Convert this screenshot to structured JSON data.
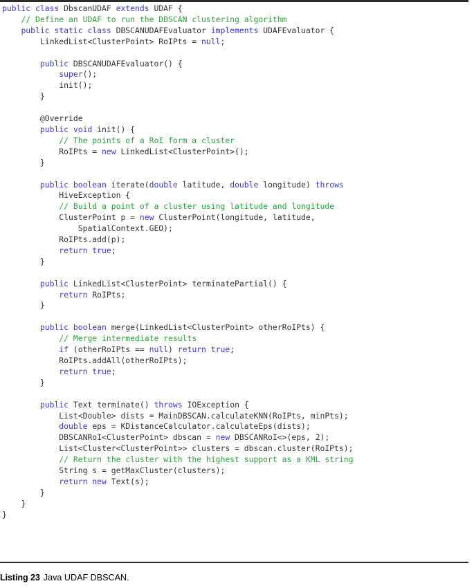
{
  "figure": {
    "kind": "code-listing",
    "caption_label": "Listing 23",
    "caption_text": "Java UDAF DBSCAN.",
    "language": "Java",
    "colors": {
      "keyword": "#3b3bd4",
      "comment": "#2fa33f",
      "plain": "#333333",
      "rule": "#2b2b2b",
      "background": "#ffffff"
    }
  },
  "code": {
    "lines": [
      [
        {
          "t": "k",
          "v": "public class "
        },
        {
          "t": "p",
          "v": "DbscanUDAF "
        },
        {
          "t": "k",
          "v": "extends "
        },
        {
          "t": "p",
          "v": "UDAF {"
        }
      ],
      [
        {
          "t": "p",
          "v": "    "
        },
        {
          "t": "c",
          "v": "// Define an UDAF to run the DBSCAN clustering algorithm"
        }
      ],
      [
        {
          "t": "p",
          "v": "    "
        },
        {
          "t": "k",
          "v": "public static class "
        },
        {
          "t": "p",
          "v": "DBSCANUDAFEvaluator "
        },
        {
          "t": "k",
          "v": "implements "
        },
        {
          "t": "p",
          "v": "UDAFEvaluator {"
        }
      ],
      [
        {
          "t": "p",
          "v": "        LinkedList<ClusterPoint> RoIPts = "
        },
        {
          "t": "k",
          "v": "null"
        },
        {
          "t": "p",
          "v": ";"
        }
      ],
      [
        {
          "t": "p",
          "v": ""
        }
      ],
      [
        {
          "t": "p",
          "v": "        "
        },
        {
          "t": "k",
          "v": "public "
        },
        {
          "t": "p",
          "v": "DBSCANUDAFEvaluator() {"
        }
      ],
      [
        {
          "t": "p",
          "v": "            "
        },
        {
          "t": "k",
          "v": "super"
        },
        {
          "t": "p",
          "v": "();"
        }
      ],
      [
        {
          "t": "p",
          "v": "            init();"
        }
      ],
      [
        {
          "t": "p",
          "v": "        }"
        }
      ],
      [
        {
          "t": "p",
          "v": ""
        }
      ],
      [
        {
          "t": "p",
          "v": "        @Override"
        }
      ],
      [
        {
          "t": "p",
          "v": "        "
        },
        {
          "t": "k",
          "v": "public void "
        },
        {
          "t": "p",
          "v": "init() {"
        }
      ],
      [
        {
          "t": "p",
          "v": "            "
        },
        {
          "t": "c",
          "v": "// The points of a RoI form a cluster"
        }
      ],
      [
        {
          "t": "p",
          "v": "            RoIPts = "
        },
        {
          "t": "k",
          "v": "new "
        },
        {
          "t": "p",
          "v": "LinkedList<ClusterPoint>();"
        }
      ],
      [
        {
          "t": "p",
          "v": "        }"
        }
      ],
      [
        {
          "t": "p",
          "v": ""
        }
      ],
      [
        {
          "t": "p",
          "v": "        "
        },
        {
          "t": "k",
          "v": "public boolean "
        },
        {
          "t": "p",
          "v": "iterate("
        },
        {
          "t": "k",
          "v": "double "
        },
        {
          "t": "p",
          "v": "latitude, "
        },
        {
          "t": "k",
          "v": "double "
        },
        {
          "t": "p",
          "v": "longitude) "
        },
        {
          "t": "k",
          "v": "throws"
        }
      ],
      [
        {
          "t": "p",
          "v": "            HiveException {"
        }
      ],
      [
        {
          "t": "p",
          "v": "            "
        },
        {
          "t": "c",
          "v": "// Build a point of a cluster using latitude and longitude"
        }
      ],
      [
        {
          "t": "p",
          "v": "            ClusterPoint p = "
        },
        {
          "t": "k",
          "v": "new "
        },
        {
          "t": "p",
          "v": "ClusterPoint(longitude, latitude,"
        }
      ],
      [
        {
          "t": "p",
          "v": "                SpatialContext.GEO);"
        }
      ],
      [
        {
          "t": "p",
          "v": "            RoIPts.add(p);"
        }
      ],
      [
        {
          "t": "p",
          "v": "            "
        },
        {
          "t": "k",
          "v": "return true"
        },
        {
          "t": "p",
          "v": ";"
        }
      ],
      [
        {
          "t": "p",
          "v": "        }"
        }
      ],
      [
        {
          "t": "p",
          "v": ""
        }
      ],
      [
        {
          "t": "p",
          "v": "        "
        },
        {
          "t": "k",
          "v": "public "
        },
        {
          "t": "p",
          "v": "LinkedList<ClusterPoint> terminatePartial() {"
        }
      ],
      [
        {
          "t": "p",
          "v": "            "
        },
        {
          "t": "k",
          "v": "return "
        },
        {
          "t": "p",
          "v": "RoIPts;"
        }
      ],
      [
        {
          "t": "p",
          "v": "        }"
        }
      ],
      [
        {
          "t": "p",
          "v": ""
        }
      ],
      [
        {
          "t": "p",
          "v": "        "
        },
        {
          "t": "k",
          "v": "public boolean "
        },
        {
          "t": "p",
          "v": "merge(LinkedList<ClusterPoint> otherRoIPts) {"
        }
      ],
      [
        {
          "t": "p",
          "v": "            "
        },
        {
          "t": "c",
          "v": "// Merge intermediate results"
        }
      ],
      [
        {
          "t": "p",
          "v": "            "
        },
        {
          "t": "k",
          "v": "if "
        },
        {
          "t": "p",
          "v": "(otherRoIPts == "
        },
        {
          "t": "k",
          "v": "null"
        },
        {
          "t": "p",
          "v": ") "
        },
        {
          "t": "k",
          "v": "return true"
        },
        {
          "t": "p",
          "v": ";"
        }
      ],
      [
        {
          "t": "p",
          "v": "            RoIPts.addAll(otherRoIPts);"
        }
      ],
      [
        {
          "t": "p",
          "v": "            "
        },
        {
          "t": "k",
          "v": "return true"
        },
        {
          "t": "p",
          "v": ";"
        }
      ],
      [
        {
          "t": "p",
          "v": "        }"
        }
      ],
      [
        {
          "t": "p",
          "v": ""
        }
      ],
      [
        {
          "t": "p",
          "v": "        "
        },
        {
          "t": "k",
          "v": "public "
        },
        {
          "t": "p",
          "v": "Text terminate() "
        },
        {
          "t": "k",
          "v": "throws "
        },
        {
          "t": "p",
          "v": "IOException {"
        }
      ],
      [
        {
          "t": "p",
          "v": "            List<Double> dists = MainDBSCAN.calculateKNN(RoIPts, minPts);"
        }
      ],
      [
        {
          "t": "p",
          "v": "            "
        },
        {
          "t": "k",
          "v": "double "
        },
        {
          "t": "p",
          "v": "eps = KDistanceCalculator.calculateEps(dists);"
        }
      ],
      [
        {
          "t": "p",
          "v": "            DBSCANRoI<ClusterPoint> dbscan = "
        },
        {
          "t": "k",
          "v": "new "
        },
        {
          "t": "p",
          "v": "DBSCANRoI<>(eps, 2);"
        }
      ],
      [
        {
          "t": "p",
          "v": "            List<Cluster<ClusterPoint>> clusters = dbscan.cluster(RoIPts);"
        }
      ],
      [
        {
          "t": "p",
          "v": "            "
        },
        {
          "t": "c",
          "v": "// Return the cluster with the highest support as a KML string"
        }
      ],
      [
        {
          "t": "p",
          "v": "            String s = getMaxCluster(clusters);"
        }
      ],
      [
        {
          "t": "p",
          "v": "            "
        },
        {
          "t": "k",
          "v": "return new "
        },
        {
          "t": "p",
          "v": "Text(s);"
        }
      ],
      [
        {
          "t": "p",
          "v": "        }"
        }
      ],
      [
        {
          "t": "p",
          "v": "    }"
        }
      ],
      [
        {
          "t": "p",
          "v": "}"
        }
      ]
    ]
  }
}
